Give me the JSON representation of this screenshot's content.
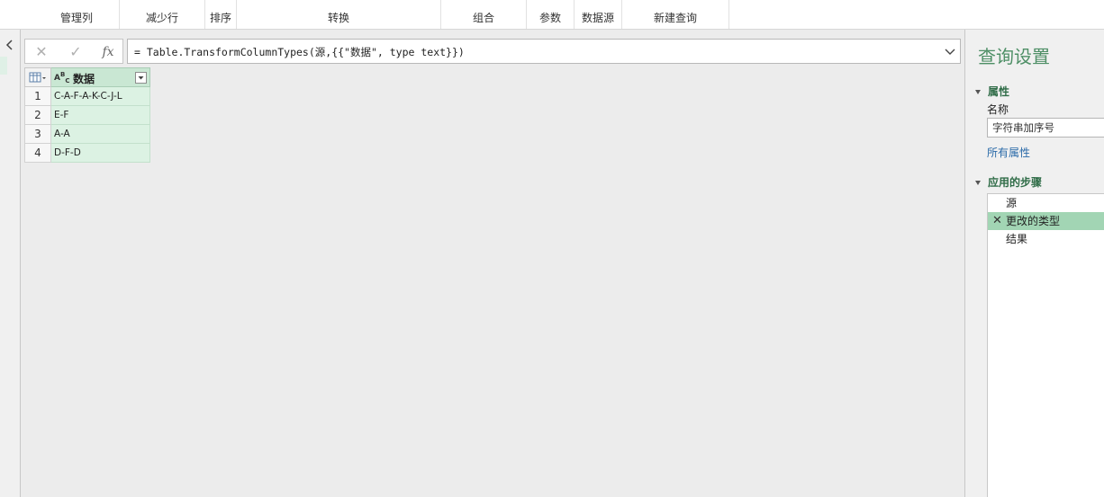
{
  "ribbon": {
    "groups": [
      "管理列",
      "减少行",
      "排序",
      "转换",
      "组合",
      "参数",
      "数据源",
      "新建查询"
    ]
  },
  "formula_bar": {
    "formula": "= Table.TransformColumnTypes(源,{{\"数据\", type text}})"
  },
  "grid": {
    "column": {
      "type_top": "A",
      "type_sup": "B",
      "type_sub": "C",
      "name": "数据"
    },
    "rows": [
      {
        "index": "1",
        "value": "C-A-F-A-K-C-J-L"
      },
      {
        "index": "2",
        "value": "E-F"
      },
      {
        "index": "3",
        "value": "A-A"
      },
      {
        "index": "4",
        "value": "D-F-D"
      }
    ]
  },
  "query_settings": {
    "title": "查询设置",
    "properties_label": "属性",
    "name_label": "名称",
    "name_value": "字符串加序号",
    "all_properties": "所有属性",
    "steps_label": "应用的步骤",
    "steps": [
      "源",
      "更改的类型",
      "结果"
    ],
    "selected_step_index": 1
  },
  "colors": {
    "accent": "#4e8f66",
    "selected_step": "#a2d5b4",
    "column_header": "#c9e7d3",
    "cell_fill": "#dcf2e3"
  }
}
